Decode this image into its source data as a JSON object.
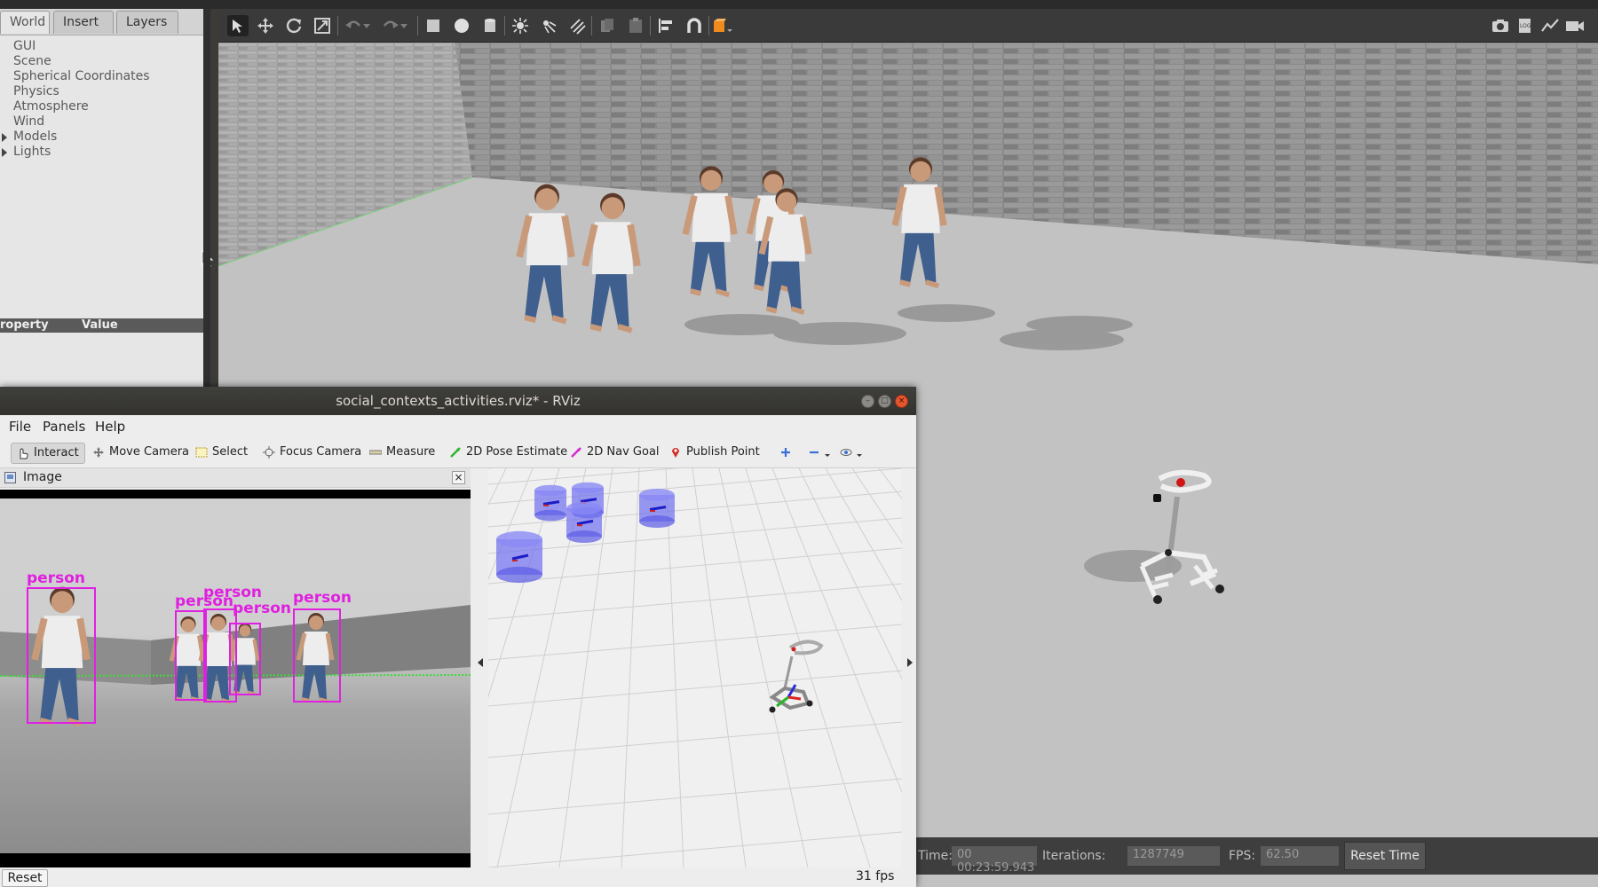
{
  "gazebo": {
    "tabs": [
      "World",
      "Insert",
      "Layers"
    ],
    "world_tree": [
      "GUI",
      "Scene",
      "Spherical Coordinates",
      "Physics",
      "Atmosphere",
      "Wind",
      "Models",
      "Lights"
    ],
    "property_header": {
      "property": "roperty",
      "value": "Value"
    },
    "toolbar_icons": [
      "select-arrow-icon",
      "translate-icon",
      "rotate-icon",
      "scale-icon",
      "undo-icon",
      "undo-dropdown-icon",
      "redo-icon",
      "redo-dropdown-icon",
      "box-icon",
      "sphere-icon",
      "cylinder-icon",
      "point-light-icon",
      "spot-light-icon",
      "directional-light-icon",
      "copy-icon",
      "paste-icon",
      "align-icon",
      "snap-icon",
      "view-angle-icon"
    ],
    "right_toolbar_icons": [
      "screenshot-icon",
      "log-icon",
      "plot-icon",
      "video-record-icon"
    ],
    "status": {
      "time_label": "Time:",
      "time_value": "00 00:23:59.943",
      "iterations_label": "Iterations:",
      "iterations_value": "1287749",
      "fps_label": "FPS:",
      "fps_value": "62.50",
      "reset_time": "Reset Time"
    }
  },
  "rviz": {
    "title": "social_contexts_activities.rviz* - RViz",
    "menu": [
      "File",
      "Panels",
      "Help"
    ],
    "tools": [
      {
        "label": "Interact",
        "icon": "interact-icon"
      },
      {
        "label": "Move Camera",
        "icon": "move-camera-icon"
      },
      {
        "label": "Select",
        "icon": "select-icon"
      },
      {
        "label": "Focus Camera",
        "icon": "focus-camera-icon"
      },
      {
        "label": "Measure",
        "icon": "measure-icon"
      },
      {
        "label": "2D Pose Estimate",
        "icon": "pose-estimate-icon"
      },
      {
        "label": "2D Nav Goal",
        "icon": "nav-goal-icon"
      },
      {
        "label": "Publish Point",
        "icon": "publish-point-icon"
      }
    ],
    "image_panel_title": "Image",
    "detections": [
      "person",
      "person",
      "person",
      "person",
      "person"
    ],
    "reset_label": "Reset",
    "fps": "31 fps"
  }
}
